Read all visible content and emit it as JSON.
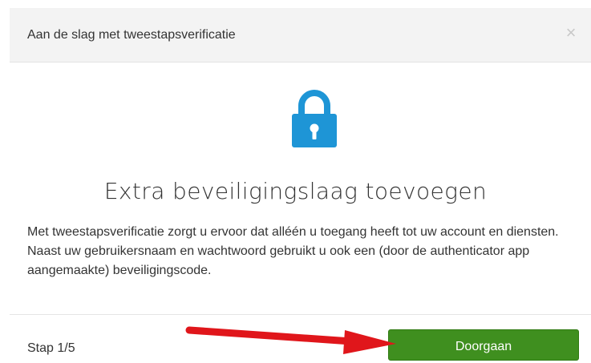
{
  "dialog": {
    "title": "Aan de slag met tweestapsverificatie",
    "close_label": "×"
  },
  "content": {
    "icon": "lock-icon",
    "heading": "Extra beveiligingslaag toevoegen",
    "description": "Met tweestapsverificatie zorgt u ervoor dat alléén u toegang heeft tot uw account en diensten. Naast uw gebruikersnaam en wachtwoord gebruikt u ook een (door de authenticator app aangemaakte) beveiligingscode."
  },
  "footer": {
    "step_label": "Stap 1/5",
    "continue_label": "Doorgaan"
  },
  "colors": {
    "accent": "#1e95d6",
    "button": "#3f8f1f",
    "arrow": "#e0161b"
  }
}
